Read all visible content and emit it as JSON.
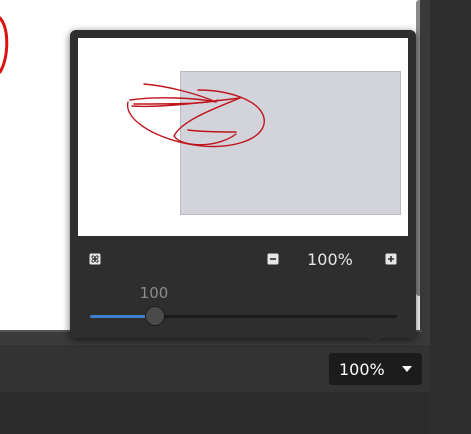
{
  "navigator": {
    "zoom_out_icon": "minus-box-icon",
    "zoom_in_icon": "plus-box-icon",
    "fit_icon": "fit-to-window-icon",
    "zoom_display": "100%",
    "slider": {
      "value_label": "100",
      "fraction": 0.212,
      "fill_color": "#3d7fd0"
    }
  },
  "status_bar": {
    "zoom_select_value": "100%"
  },
  "colors": {
    "stroke": "#c0141c",
    "viewport": "#d3d3dc",
    "panel": "#2e2e2e"
  }
}
